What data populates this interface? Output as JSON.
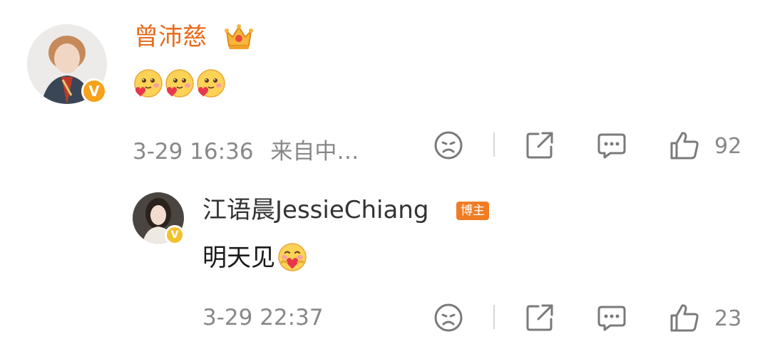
{
  "comment": {
    "author": "曾沛慈",
    "author_badge_icon": "crown-icon",
    "verified_badge": "V",
    "content_emojis": [
      "heart-face-emoji",
      "heart-face-emoji",
      "heart-face-emoji"
    ],
    "timestamp": "3-29 16:36",
    "source": "来自中…",
    "like_count": "92"
  },
  "reply": {
    "author": "江语晨JessieChiang",
    "author_tag": "博主",
    "verified_badge": "V",
    "content_text": "明天见",
    "content_emoji": "hug-face-emoji",
    "timestamp": "3-29 22:37",
    "like_count": "23"
  },
  "watermark": "",
  "colors": {
    "author_orange": "#e86a1b",
    "badge_orange": "#f7a21b",
    "meta_gray": "#888888",
    "blogger_tag": "#f07c24"
  }
}
